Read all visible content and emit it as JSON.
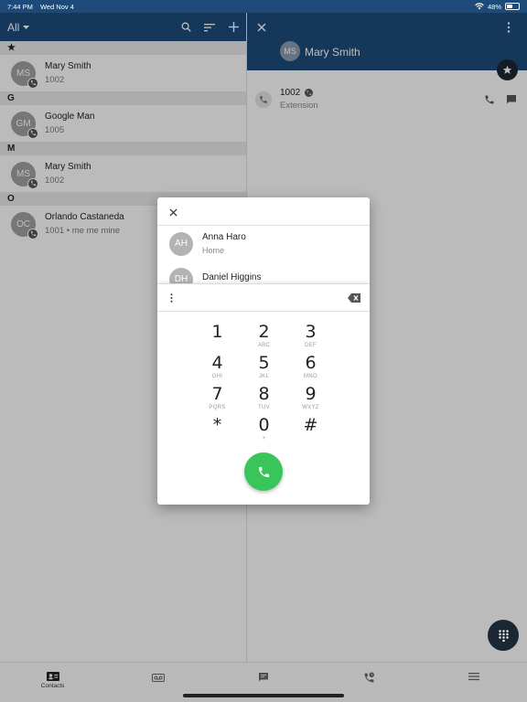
{
  "status_bar": {
    "time": "7:44 PM",
    "date": "Wed Nov 4",
    "battery": "48%",
    "battery_level": 0.48
  },
  "left_header": {
    "filter_label": "All"
  },
  "contacts": [
    {
      "section": "★",
      "name": "Mary Smith",
      "initials": "MS",
      "sub": "1002"
    },
    {
      "section": "G",
      "name": "Google Man",
      "initials": "GM",
      "sub": "1005"
    },
    {
      "section": "M",
      "name": "Mary Smith",
      "initials": "MS",
      "sub": "1002"
    },
    {
      "section": "O",
      "name": "Orlando Castaneda",
      "initials": "OC",
      "sub": "1001 • me me mine"
    }
  ],
  "detail": {
    "initials": "MS",
    "name": "Mary Smith",
    "extension_number": "1002",
    "extension_label": "Extension"
  },
  "dialer": {
    "suggestions": [
      {
        "initials": "AH",
        "name": "Anna Haro",
        "sub": "Home"
      },
      {
        "initials": "DH",
        "name": "Daniel Higgins",
        "sub": ""
      }
    ],
    "input_value": "",
    "keys": [
      {
        "digit": "1",
        "letters": ""
      },
      {
        "digit": "2",
        "letters": "ABC"
      },
      {
        "digit": "3",
        "letters": "DEF"
      },
      {
        "digit": "4",
        "letters": "GHI"
      },
      {
        "digit": "5",
        "letters": "JKL"
      },
      {
        "digit": "6",
        "letters": "MNO"
      },
      {
        "digit": "7",
        "letters": "PQRS"
      },
      {
        "digit": "8",
        "letters": "TUV"
      },
      {
        "digit": "9",
        "letters": "WXYZ"
      },
      {
        "digit": "*",
        "letters": ""
      },
      {
        "digit": "0",
        "letters": "+"
      },
      {
        "digit": "#",
        "letters": ""
      }
    ]
  },
  "bottom_nav": {
    "contacts_label": "Contacts"
  },
  "colors": {
    "header": "#1d4a78",
    "call_green": "#3ac55a",
    "fab_dark": "#1b2733"
  }
}
